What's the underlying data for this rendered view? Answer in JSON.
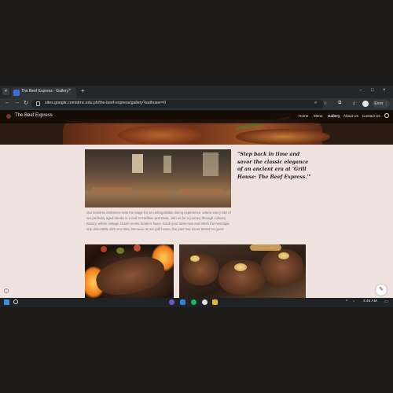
{
  "browser": {
    "tab_title": "The Beef Express - Gallery",
    "new_tab_symbol": "+",
    "close_symbol": "×",
    "url": "sites.google.com/drnc.edu.ph/the-beef-express/gallery?authuser=0",
    "error_label": "Error",
    "window_controls": [
      "–",
      "□",
      "×"
    ]
  },
  "site": {
    "title": "The Beef Express",
    "nav": [
      "Home",
      "Menu",
      "Gallery",
      "About Us",
      "Contact Us"
    ],
    "active_nav": "Gallery",
    "quote": "\"Step back in time and savor the classic elegance of an ancient era at 'Grill House: The Beef Express.'\"",
    "body_text": "Our timeless ambience sets the stage for an unforgettable dining experience, where every bite of our perfectly aged steaks is a nod to tradition and taste. Join us for a journey through culinary history, where vintage charm meets modern flavor. Book your table now and relish the nostalgia, one delectable dish at a time. Because at our grill house, the past has never tasted so good."
  },
  "taskbar": {
    "time": "4:45 AM"
  },
  "icons": [
    "tab-list-icon",
    "back-icon",
    "forward-icon",
    "reload-icon",
    "lock-icon",
    "zoom-icon",
    "bookmark-star-icon",
    "extensions-icon",
    "download-icon",
    "profile-avatar-icon",
    "menu-icon",
    "search-icon",
    "edit-icon",
    "info-icon",
    "start-icon",
    "windows-search-icon"
  ]
}
